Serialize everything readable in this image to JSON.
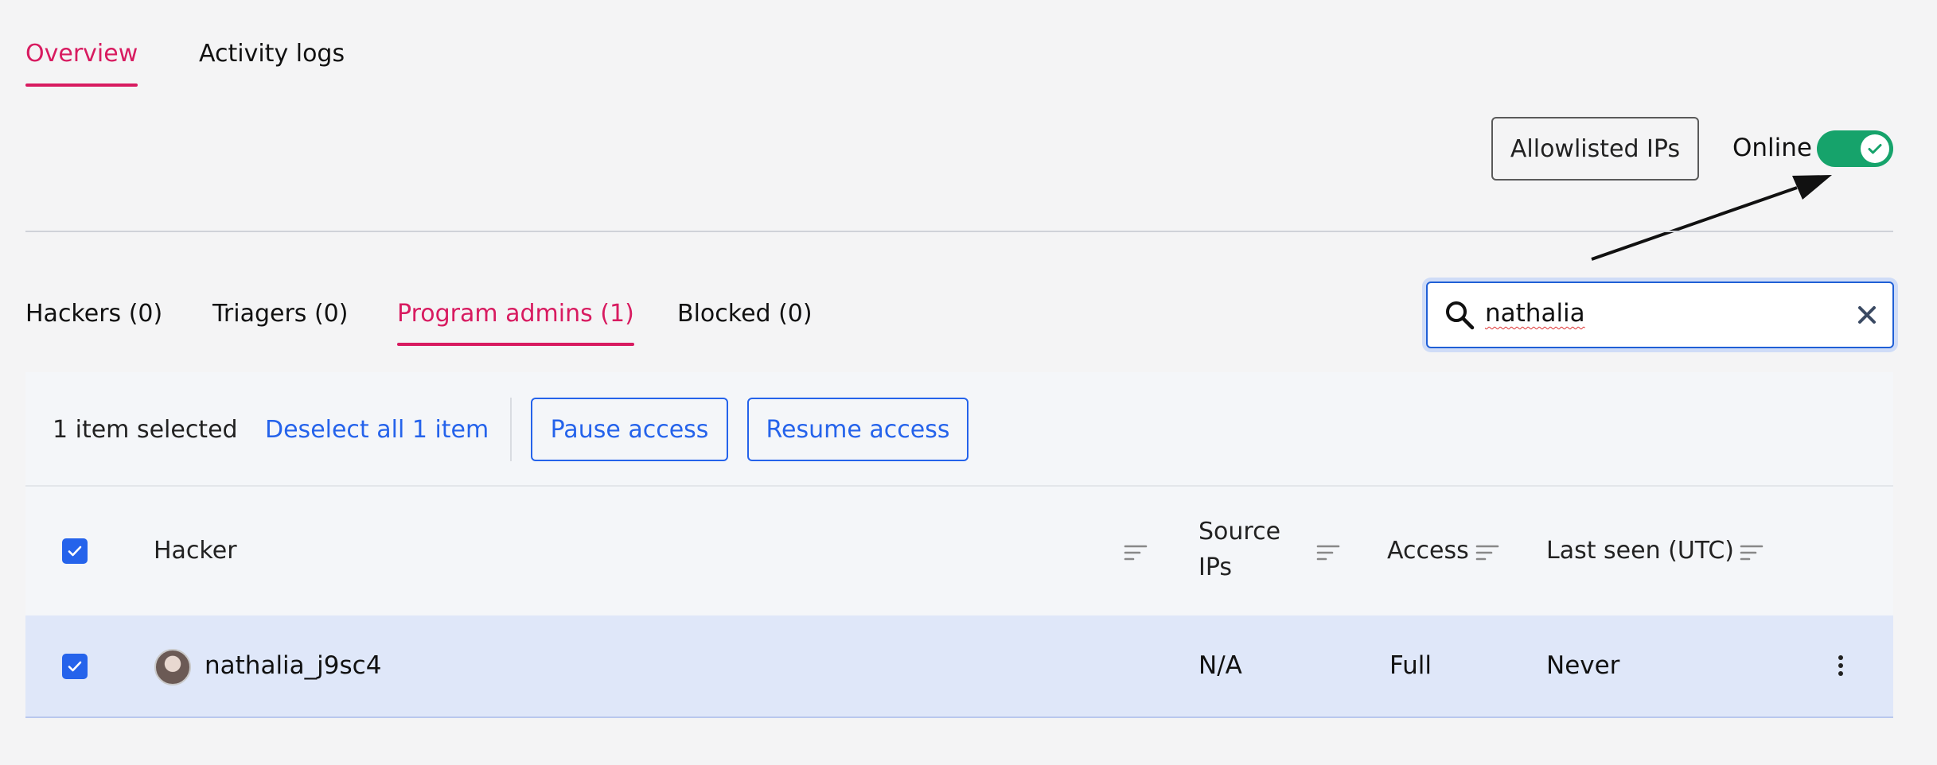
{
  "top_tabs": [
    {
      "label": "Overview",
      "active": true
    },
    {
      "label": "Activity logs",
      "active": false
    }
  ],
  "header_actions": {
    "allowlisted_label": "Allowlisted IPs",
    "online_label": "Online",
    "online_toggle": true
  },
  "sub_tabs": [
    {
      "label": "Hackers (0)",
      "active": false
    },
    {
      "label": "Triagers (0)",
      "active": false
    },
    {
      "label": "Program admins (1)",
      "active": true
    },
    {
      "label": "Blocked (0)",
      "active": false
    }
  ],
  "search": {
    "value": "nathalia"
  },
  "bulk": {
    "selected_text": "1 item selected",
    "deselect_label": "Deselect all 1 item",
    "pause_label": "Pause access",
    "resume_label": "Resume access"
  },
  "table": {
    "columns": {
      "hacker": "Hacker",
      "source_ips_1": "Source",
      "source_ips_2": "IPs",
      "access": "Access",
      "last_seen": "Last seen (UTC)"
    },
    "rows": [
      {
        "hacker": "nathalia_j9sc4",
        "source_ips": "N/A",
        "access": "Full",
        "last_seen": "Never",
        "selected": true
      }
    ]
  },
  "colors": {
    "accent": "#d81b60",
    "link": "#2563eb",
    "toggle_on": "#16a36b",
    "row_selected": "#dfe7f9"
  }
}
